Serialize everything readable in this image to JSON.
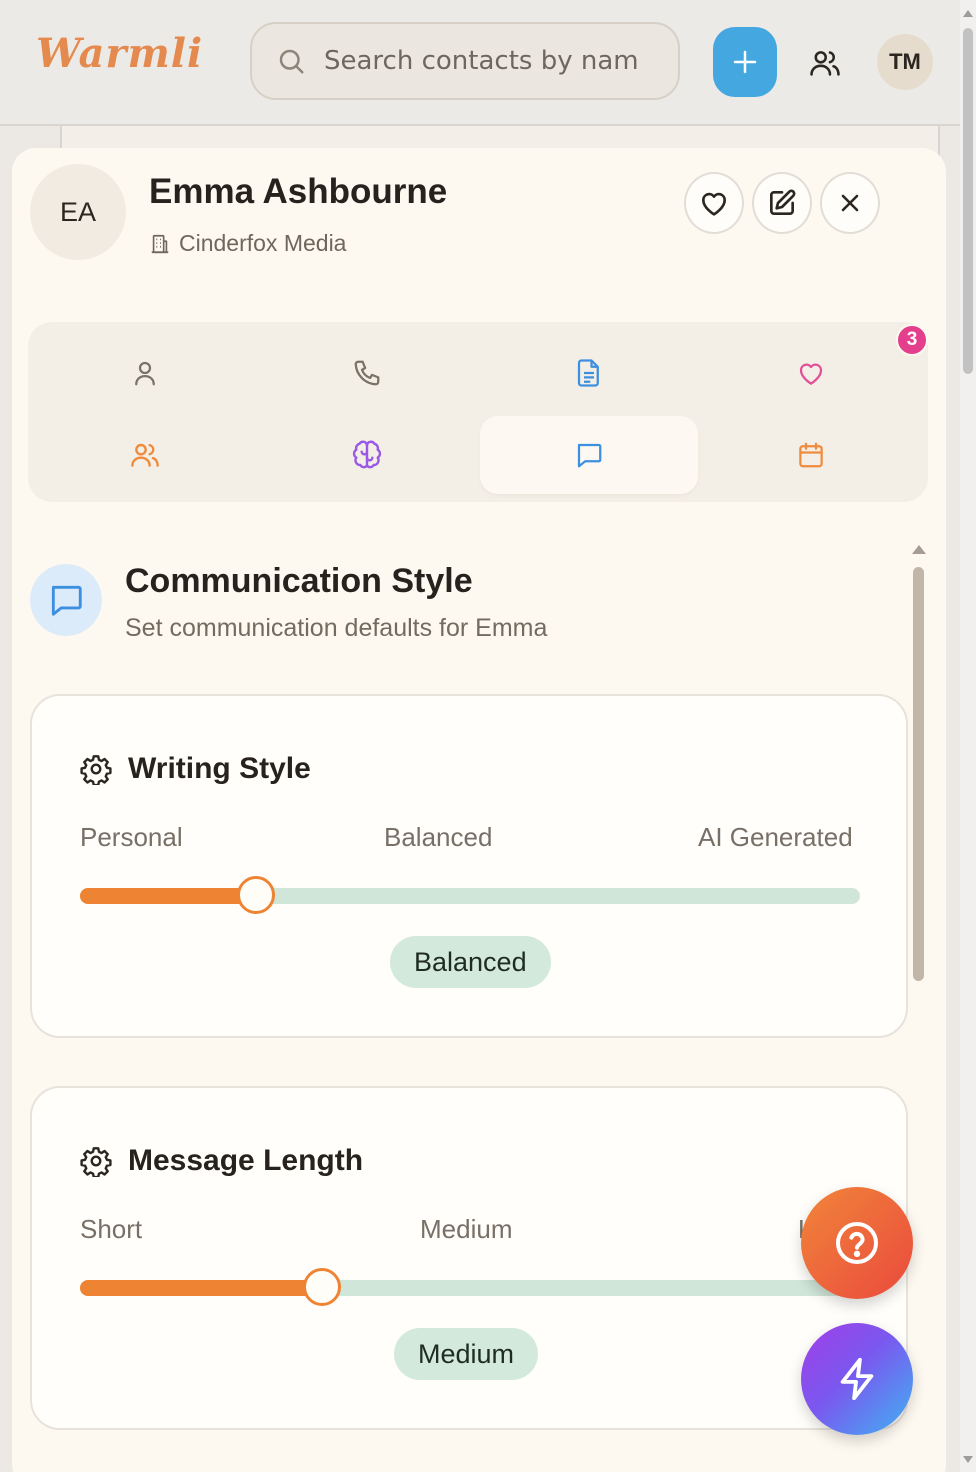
{
  "app": {
    "logo": "Warmli"
  },
  "topbar": {
    "search_placeholder": "Search contacts by nam",
    "user_initials": "TM"
  },
  "contact": {
    "initials": "EA",
    "name": "Emma Ashbourne",
    "company": "Cinderfox Media"
  },
  "tabs": [
    {
      "icon": "user-icon",
      "color": "#7a7266"
    },
    {
      "icon": "phone-icon",
      "color": "#7a7266"
    },
    {
      "icon": "document-icon",
      "color": "#3d8fe0"
    },
    {
      "icon": "heart-icon",
      "color": "#e24e97"
    },
    {
      "icon": "users-icon",
      "color": "#ef8b3c"
    },
    {
      "icon": "brain-icon",
      "color": "#9a58e6"
    },
    {
      "icon": "message-icon",
      "color": "#3d8fe0",
      "active": true
    },
    {
      "icon": "calendar-icon",
      "color": "#ef8b3c"
    }
  ],
  "notification_count": "3",
  "section": {
    "title": "Communication Style",
    "subtitle": "Set communication defaults for Emma"
  },
  "settings": [
    {
      "title": "Writing Style",
      "labels": [
        "Personal",
        "Balanced",
        "AI Generated"
      ],
      "value": "Balanced",
      "level": 0.225
    },
    {
      "title": "Message Length",
      "labels": [
        "Short",
        "Medium",
        "L"
      ],
      "value": "Medium",
      "level": 0.31
    }
  ],
  "colors": {
    "accent_orange": "#ee8433",
    "track_green": "#cfe6d8",
    "brand_blue": "#44a7e0"
  }
}
